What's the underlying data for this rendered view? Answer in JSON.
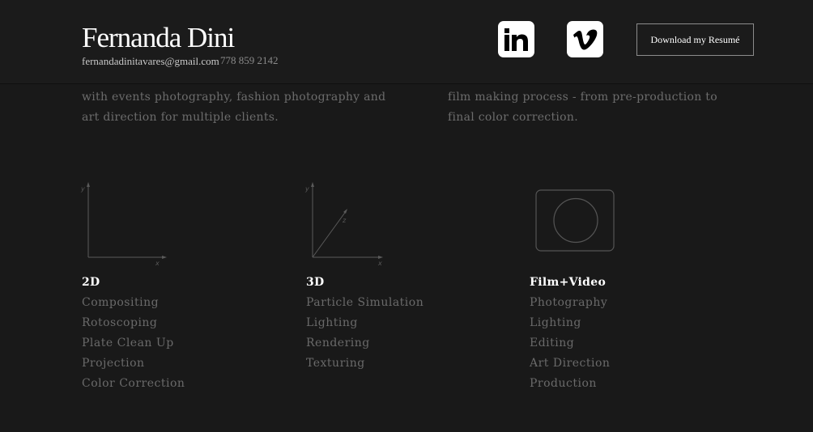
{
  "header": {
    "name": "Fernanda Dini",
    "email": "fernandadinitavares@gmail.com",
    "phone": "778 859 2142",
    "resume_button": "Download my Resumé",
    "social": [
      {
        "name": "linkedin-icon",
        "label": "in"
      },
      {
        "name": "vimeo-icon",
        "label": "v"
      }
    ]
  },
  "intro": {
    "left": "with events photography, fashion photography and art direction for multiple clients.",
    "right": "film making process - from pre-production to final color correction."
  },
  "illustrations": {
    "two_d": {
      "y_label": "y",
      "x_label": "x"
    },
    "three_d": {
      "y_label": "y",
      "z_label": "z",
      "x_label": "x"
    }
  },
  "skills": [
    {
      "title": "2D",
      "items": [
        "Compositing",
        "Rotoscoping",
        "Plate Clean Up",
        "Projection",
        "Color Correction"
      ]
    },
    {
      "title": "3D",
      "items": [
        "Particle Simulation",
        "Lighting",
        "Rendering",
        "Texturing"
      ]
    },
    {
      "title": "Film+Video",
      "items": [
        "Photography",
        "Lighting",
        "Editing",
        "Art Direction",
        "Production"
      ]
    }
  ],
  "colors": {
    "background": "#191919",
    "header": "#1b1b1b",
    "text_muted": "#6a6a6a",
    "text_bright": "#ffffff"
  }
}
